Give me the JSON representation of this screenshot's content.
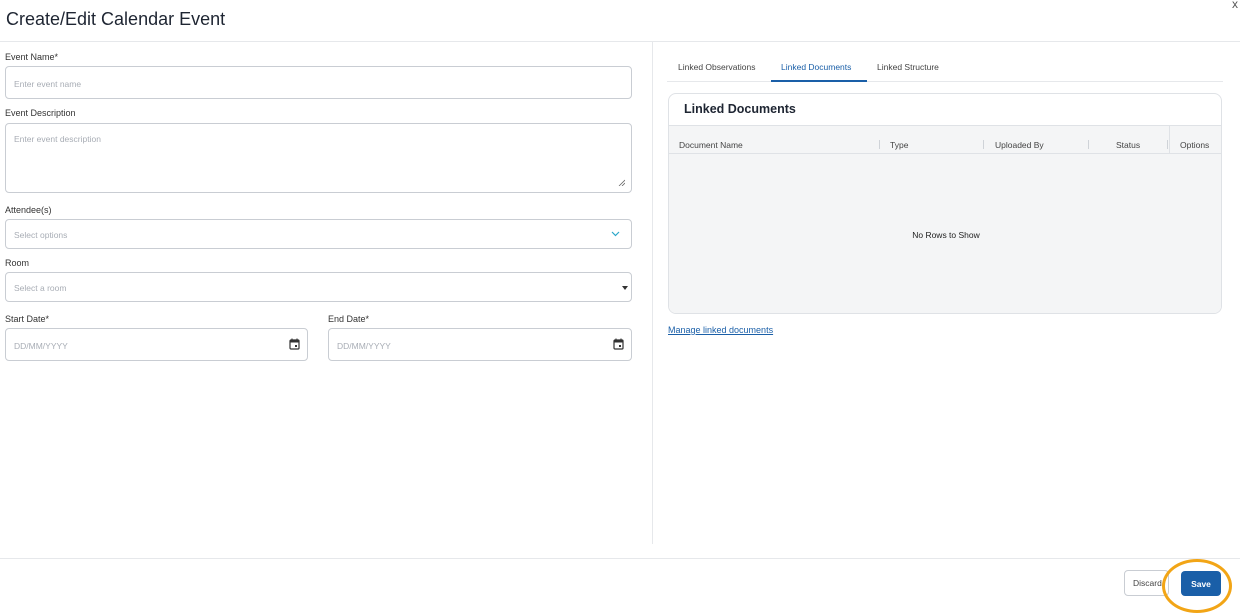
{
  "modal": {
    "title": "Create/Edit Calendar Event",
    "close_label": "x"
  },
  "form": {
    "event_name": {
      "label": "Event Name*",
      "placeholder": "Enter event name",
      "value": ""
    },
    "event_description": {
      "label": "Event Description",
      "placeholder": "Enter event description",
      "value": ""
    },
    "attendees": {
      "label": "Attendee(s)",
      "placeholder": "Select options"
    },
    "room": {
      "label": "Room",
      "placeholder": "Select a room"
    },
    "start_date": {
      "label": "Start Date*",
      "placeholder": "DD/MM/YYYY"
    },
    "end_date": {
      "label": "End Date*",
      "placeholder": "DD/MM/YYYY"
    }
  },
  "tabs": [
    {
      "label": "Linked Observations",
      "active": false
    },
    {
      "label": "Linked Documents",
      "active": true
    },
    {
      "label": "Linked Structure",
      "active": false
    }
  ],
  "documents_grid": {
    "title": "Linked Documents",
    "columns": [
      "Document Name",
      "Type",
      "Uploaded By",
      "Status",
      "Options"
    ],
    "rows": [],
    "empty_message": "No Rows to Show"
  },
  "manage_link": "Manage linked documents",
  "footer": {
    "discard_label": "Discard",
    "save_label": "Save"
  },
  "colors": {
    "primary": "#1a5fa8",
    "highlight": "#f2a516",
    "chevron": "#2aa7c9"
  }
}
